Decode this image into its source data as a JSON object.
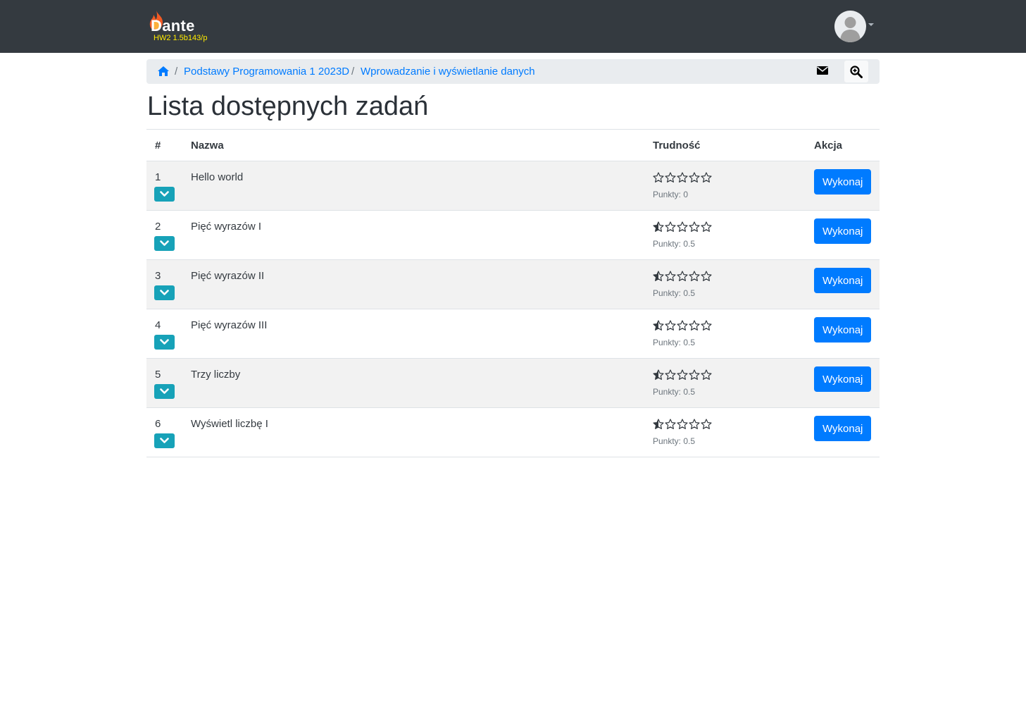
{
  "brand": {
    "name": "Dante",
    "version": "HW2 1.5b143/p"
  },
  "breadcrumb": {
    "home_icon": "home-icon",
    "separator": "/",
    "items": [
      "Podstawy Programowania 1 2023D",
      "Wprowadzanie i wyświetlanie danych"
    ],
    "icons": [
      "envelope-icon",
      "search-plus-icon"
    ]
  },
  "page": {
    "title": "Lista dostępnych zadań"
  },
  "table": {
    "headers": {
      "num": "#",
      "name": "Nazwa",
      "difficulty": "Trudność",
      "action": "Akcja"
    },
    "rows": [
      {
        "num": "1",
        "name": "Hello world",
        "points": "Punkty: 0",
        "rating": 0,
        "action": "Wykonaj"
      },
      {
        "num": "2",
        "name": "Pięć wyrazów I",
        "points": "Punkty: 0.5",
        "rating": 0.5,
        "action": "Wykonaj"
      },
      {
        "num": "3",
        "name": "Pięć wyrazów II",
        "points": "Punkty: 0.5",
        "rating": 0.5,
        "action": "Wykonaj"
      },
      {
        "num": "4",
        "name": "Pięć wyrazów III",
        "points": "Punkty: 0.5",
        "rating": 0.5,
        "action": "Wykonaj"
      },
      {
        "num": "5",
        "name": "Trzy liczby",
        "points": "Punkty: 0.5",
        "rating": 0.5,
        "action": "Wykonaj"
      },
      {
        "num": "6",
        "name": "Wyświetl liczbę I",
        "points": "Punkty: 0.5",
        "rating": 0.5,
        "action": "Wykonaj"
      }
    ],
    "max_rating": 5
  },
  "colors": {
    "navbar": "#343a40",
    "primary": "#007bff",
    "info": "#17a2b8",
    "version": "#ffeb00"
  }
}
